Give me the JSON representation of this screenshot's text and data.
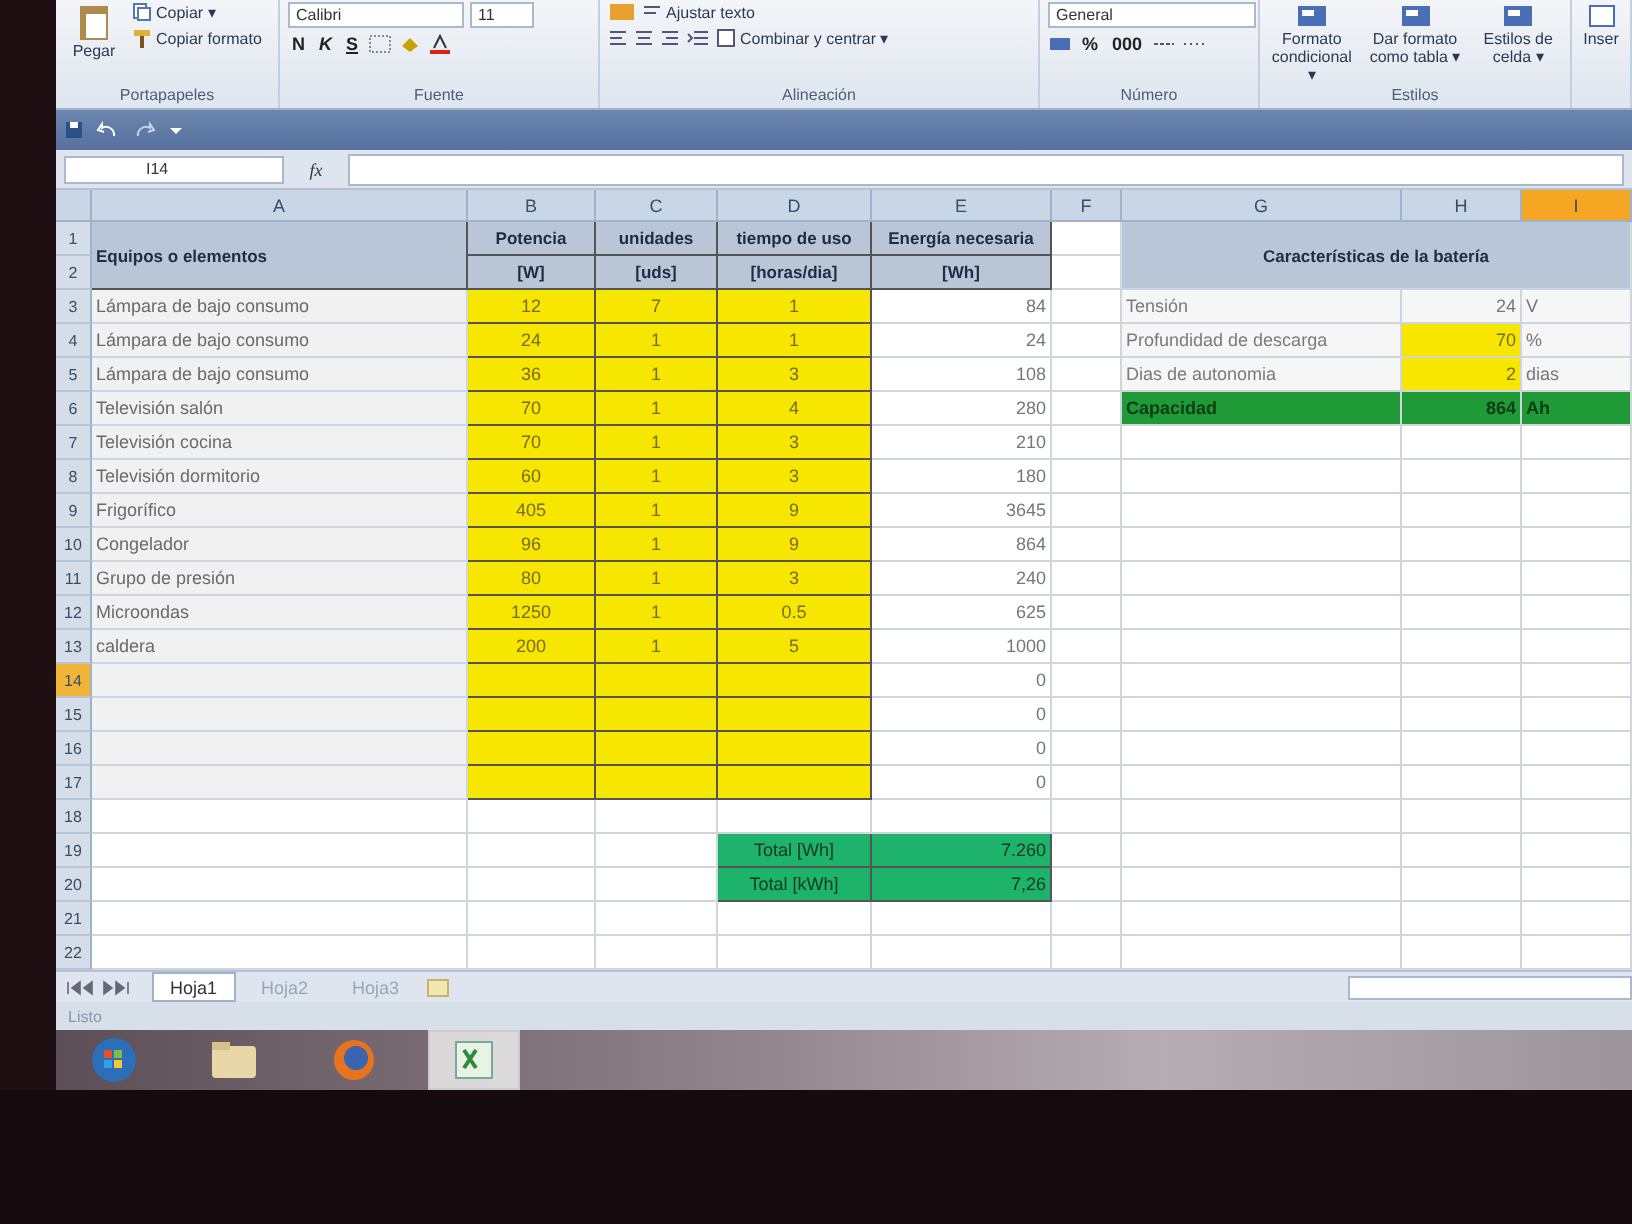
{
  "ribbon": {
    "groups": [
      {
        "kind": "clipboard",
        "label": "Portapapeles",
        "paste": "Pegar",
        "copy": "Copiar ▾",
        "format_painter": "Copiar formato"
      },
      {
        "kind": "font",
        "label": "Fuente",
        "font": "Calibri",
        "size": "11",
        "styles": [
          "N",
          "K",
          "S"
        ]
      },
      {
        "kind": "alignment",
        "label": "Alineación",
        "wrap": "Ajustar texto",
        "merge": "Combinar y centrar ▾"
      },
      {
        "kind": "number",
        "label": "Número",
        "format": "General",
        "percent": "%",
        "thousands": "000"
      },
      {
        "kind": "styles",
        "label": "Estilos",
        "buttons": [
          "Formato condicional ▾",
          "Dar formato como tabla ▾",
          "Estilos de celda ▾"
        ]
      },
      {
        "kind": "cells",
        "buttons": [
          "Inser"
        ]
      }
    ]
  },
  "formula_bar": {
    "name_box": "I14",
    "function_label": "fx"
  },
  "columns": [
    {
      "label": "A",
      "selected": false
    },
    {
      "label": "B",
      "selected": false
    },
    {
      "label": "C",
      "selected": false
    },
    {
      "label": "D",
      "selected": false
    },
    {
      "label": "E",
      "selected": false
    },
    {
      "label": "F",
      "selected": false
    },
    {
      "label": "G",
      "selected": false
    },
    {
      "label": "H",
      "selected": false
    },
    {
      "label": "I",
      "selected": true
    }
  ],
  "rows": [
    {
      "label": "1",
      "selected": false
    },
    {
      "label": "2",
      "selected": false
    },
    {
      "label": "3",
      "selected": false
    },
    {
      "label": "4",
      "selected": false
    },
    {
      "label": "5",
      "selected": false
    },
    {
      "label": "6",
      "selected": false
    },
    {
      "label": "7",
      "selected": false
    },
    {
      "label": "8",
      "selected": false
    },
    {
      "label": "9",
      "selected": false
    },
    {
      "label": "10",
      "selected": false
    },
    {
      "label": "11",
      "selected": false
    },
    {
      "label": "12",
      "selected": false
    },
    {
      "label": "13",
      "selected": false
    },
    {
      "label": "14",
      "selected": true
    },
    {
      "label": "15",
      "selected": false
    },
    {
      "label": "16",
      "selected": false
    },
    {
      "label": "17",
      "selected": false
    },
    {
      "label": "18",
      "selected": false
    },
    {
      "label": "19",
      "selected": false
    },
    {
      "label": "20",
      "selected": false
    },
    {
      "label": "21",
      "selected": false
    },
    {
      "label": "22",
      "selected": false
    }
  ],
  "equipment_table": {
    "title": "Equipos o elementos",
    "headers": [
      {
        "name": "Potencia",
        "unit": "[W]"
      },
      {
        "name": "unidades",
        "unit": "[uds]"
      },
      {
        "name": "tiempo de uso",
        "unit": "[horas/dia]"
      },
      {
        "name": "Energía necesaria",
        "unit": "[Wh]"
      }
    ],
    "items": [
      {
        "name": "Lámpara de bajo consumo",
        "power": "12",
        "units": "7",
        "hours": "1",
        "energy": "84"
      },
      {
        "name": "Lámpara de bajo consumo",
        "power": "24",
        "units": "1",
        "hours": "1",
        "energy": "24"
      },
      {
        "name": "Lámpara de bajo consumo",
        "power": "36",
        "units": "1",
        "hours": "3",
        "energy": "108"
      },
      {
        "name": "Televisión salón",
        "power": "70",
        "units": "1",
        "hours": "4",
        "energy": "280"
      },
      {
        "name": "Televisión cocina",
        "power": "70",
        "units": "1",
        "hours": "3",
        "energy": "210"
      },
      {
        "name": "Televisión dormitorio",
        "power": "60",
        "units": "1",
        "hours": "3",
        "energy": "180"
      },
      {
        "name": "Frigorífico",
        "power": "405",
        "units": "1",
        "hours": "9",
        "energy": "3645"
      },
      {
        "name": "Congelador",
        "power": "96",
        "units": "1",
        "hours": "9",
        "energy": "864"
      },
      {
        "name": "Grupo de presión",
        "power": "80",
        "units": "1",
        "hours": "3",
        "energy": "240"
      },
      {
        "name": "Microondas",
        "power": "1250",
        "units": "1",
        "hours": "0.5",
        "energy": "625"
      },
      {
        "name": "caldera",
        "power": "200",
        "units": "1",
        "hours": "5",
        "energy": "1000"
      },
      {
        "energy": "0"
      },
      {
        "energy": "0"
      },
      {
        "energy": "0"
      },
      {
        "energy": "0"
      }
    ],
    "totals": [
      {
        "label": "Total [Wh]",
        "value": "7.260"
      },
      {
        "label": "Total [kWh]",
        "value": "7,26"
      }
    ]
  },
  "battery": {
    "title": "Características de la batería",
    "rows": [
      {
        "kind": "plain",
        "label": "Tensión",
        "value": "24",
        "unit": "V"
      },
      {
        "kind": "input",
        "label": "Profundidad de descarga",
        "value": "70",
        "unit": "%"
      },
      {
        "kind": "input",
        "label": "Dias de autonomia",
        "value": "2",
        "unit": "dias"
      },
      {
        "kind": "result",
        "label": "Capacidad",
        "value": "864",
        "unit": "Ah"
      }
    ]
  },
  "sheet_tabs": [
    {
      "label": "Hoja1",
      "selected": true
    },
    {
      "label": "Hoja2",
      "selected": false
    },
    {
      "label": "Hoja3",
      "selected": false
    }
  ],
  "status_bar": {
    "text": "Listo"
  },
  "taskbar": {
    "apps": [
      {
        "kind": "start",
        "active": false
      },
      {
        "kind": "folder",
        "active": false
      },
      {
        "kind": "browser",
        "active": false
      },
      {
        "kind": "spreadsheet",
        "active": true
      }
    ]
  }
}
